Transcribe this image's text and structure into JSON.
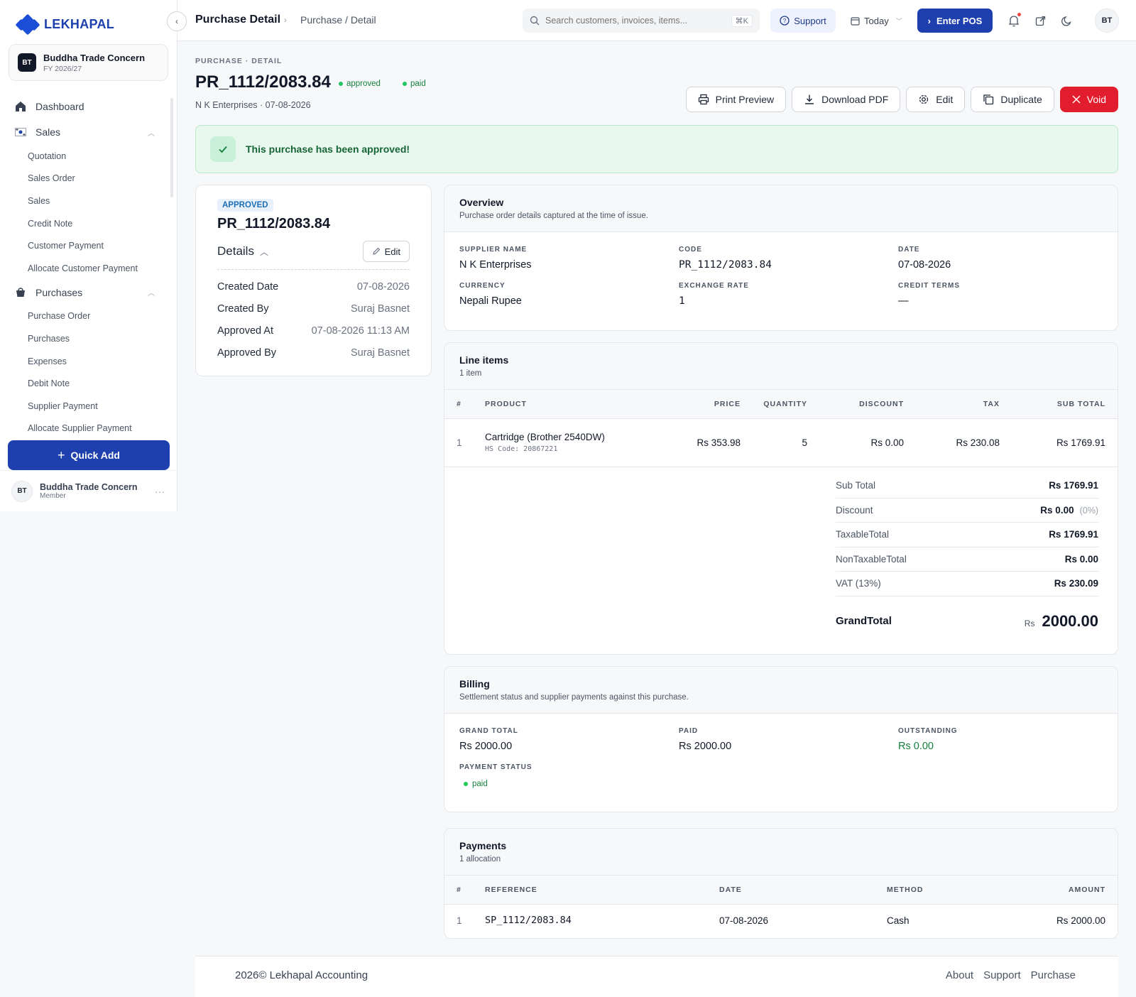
{
  "brand": {
    "name": "LEKHAPAL"
  },
  "org": {
    "initials": "BT",
    "name": "Buddha Trade Concern",
    "fy": "FY 2026/27"
  },
  "nav": {
    "dashboard": "Dashboard",
    "sales": "Sales",
    "sales_items": [
      "Quotation",
      "Sales Order",
      "Sales",
      "Credit Note",
      "Customer Payment",
      "Allocate Customer Payment"
    ],
    "purchases": "Purchases",
    "purchase_items": [
      "Purchase Order",
      "Purchases",
      "Expenses",
      "Debit Note",
      "Supplier Payment",
      "Allocate Supplier Payment"
    ]
  },
  "quick_add": "Quick Add",
  "user": {
    "initials": "BT",
    "name": "Buddha Trade Concern",
    "role": "Member"
  },
  "topbar": {
    "title": "Purchase Detail",
    "path": "Purchase / Detail",
    "search_placeholder": "Search customers, invoices, items...",
    "search_shortcut": "⌘K",
    "support": "Support",
    "today": "Today",
    "pos": "Enter POS",
    "avatar": "BT"
  },
  "page": {
    "eyebrow": "PURCHASE · DETAIL",
    "title": "PR_1112/2083.84",
    "status": "approved",
    "payment": "paid",
    "subline": "N K Enterprises · 07-08-2026",
    "actions": {
      "print": "Print Preview",
      "pdf": "Download PDF",
      "edit": "Edit",
      "duplicate": "Duplicate",
      "void": "Void"
    },
    "alert": "This purchase has been approved!"
  },
  "detail_card": {
    "status": "APPROVED",
    "title": "PR_1112/2083.84",
    "details_label": "Details",
    "edit": "Edit",
    "rows": [
      {
        "k": "Created Date",
        "v": "07-08-2026"
      },
      {
        "k": "Created By",
        "v": "Suraj Basnet"
      },
      {
        "k": "Approved At",
        "v": "07-08-2026 11:13 AM"
      },
      {
        "k": "Approved By",
        "v": "Suraj Basnet"
      }
    ]
  },
  "overview": {
    "title": "Overview",
    "subtitle": "Purchase order details captured at the time of issue.",
    "fields": [
      {
        "label": "SUPPLIER NAME",
        "value": "N K Enterprises"
      },
      {
        "label": "CODE",
        "value": "PR_1112/2083.84"
      },
      {
        "label": "DATE",
        "value": "07-08-2026"
      },
      {
        "label": "CURRENCY",
        "value": "Nepali Rupee"
      },
      {
        "label": "EXCHANGE RATE",
        "value": "1"
      },
      {
        "label": "CREDIT TERMS",
        "value": "—"
      }
    ]
  },
  "lines": {
    "title": "Line items",
    "subtitle": "1 item",
    "headers": [
      "#",
      "PRODUCT",
      "PRICE",
      "QUANTITY",
      "DISCOUNT",
      "TAX",
      "SUB TOTAL"
    ],
    "rows": [
      {
        "n": "1",
        "product": "Cartridge (Brother 2540DW)",
        "hs": "HS Code: 20867221",
        "price": "Rs 353.98",
        "qty": "5",
        "discount": "Rs 0.00",
        "tax": "Rs 230.08",
        "subtotal": "Rs 1769.91"
      }
    ],
    "totals": [
      {
        "k": "Sub Total",
        "v": "Rs 1769.91"
      },
      {
        "k": "Discount",
        "v": "Rs 0.00",
        "pct": "(0%)"
      },
      {
        "k": "TaxableTotal",
        "v": "Rs 1769.91"
      },
      {
        "k": "NonTaxableTotal",
        "v": "Rs 0.00"
      },
      {
        "k": "VAT (13%)",
        "v": "Rs 230.09"
      }
    ],
    "grand": {
      "k": "GrandTotal",
      "cur": "Rs",
      "amt": "2000.00"
    }
  },
  "billing": {
    "title": "Billing",
    "subtitle": "Settlement status and supplier payments against this purchase.",
    "fields": [
      {
        "label": "GRAND TOTAL",
        "value": "Rs 2000.00"
      },
      {
        "label": "PAID",
        "value": "Rs 2000.00"
      },
      {
        "label": "OUTSTANDING",
        "value": "Rs 0.00"
      }
    ],
    "status_label": "PAYMENT STATUS",
    "status": "paid"
  },
  "payments": {
    "title": "Payments",
    "subtitle": "1 allocation",
    "headers": [
      "#",
      "REFERENCE",
      "DATE",
      "METHOD",
      "AMOUNT"
    ],
    "rows": [
      {
        "n": "1",
        "ref": "SP_1112/2083.84",
        "date": "07-08-2026",
        "method": "Cash",
        "amount": "Rs 2000.00"
      }
    ]
  },
  "footer": {
    "copyright": "2026© Lekhapal Accounting",
    "links": [
      "About",
      "Support",
      "Purchase"
    ]
  }
}
